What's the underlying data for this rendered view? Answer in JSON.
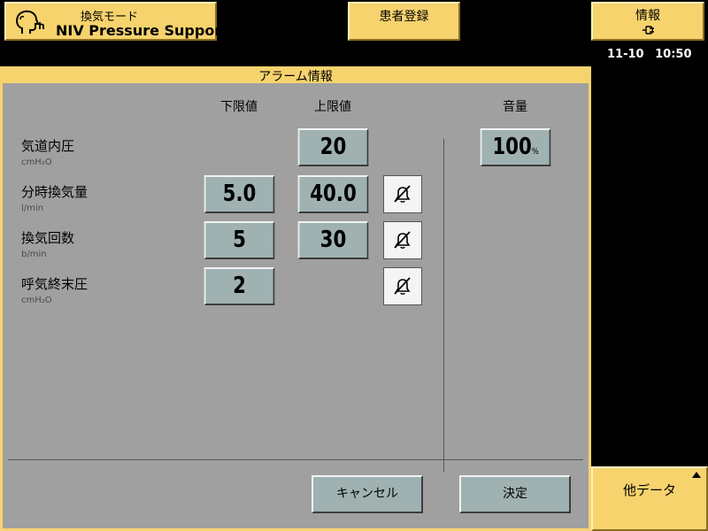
{
  "top_bar": {
    "mode": {
      "label": "換気モード",
      "value": "NIV Pressure Support",
      "icon": "patient-head-icon"
    },
    "patient_registration": {
      "label": "患者登録"
    },
    "info": {
      "label": "情報",
      "icon": "plug-icon"
    },
    "date": "11-10",
    "time": "10:50"
  },
  "panel": {
    "title": "アラーム情報",
    "columns": {
      "lower": "下限値",
      "upper": "上限値",
      "volume": "音量"
    },
    "rows": [
      {
        "label": "気道内圧",
        "unit": "cmH₂O",
        "lower": null,
        "upper": "20",
        "mute": false
      },
      {
        "label": "分時換気量",
        "unit": "l/min",
        "lower": "5.0",
        "upper": "40.0",
        "mute": true
      },
      {
        "label": "換気回数",
        "unit": "b/min",
        "lower": "5",
        "upper": "30",
        "mute": true
      },
      {
        "label": "呼気終末圧",
        "unit": "cmH₂O",
        "lower": "2",
        "upper": null,
        "mute": true
      }
    ],
    "volume": {
      "value": "100",
      "unit": "%"
    },
    "buttons": {
      "cancel": "キャンセル",
      "ok": "決定"
    }
  },
  "side": {
    "other_data": "他データ"
  },
  "colors": {
    "accent": "#f7d36e",
    "panel_bg": "#a0a0a0",
    "value_box": "#9fb1b1",
    "background": "#000000"
  }
}
